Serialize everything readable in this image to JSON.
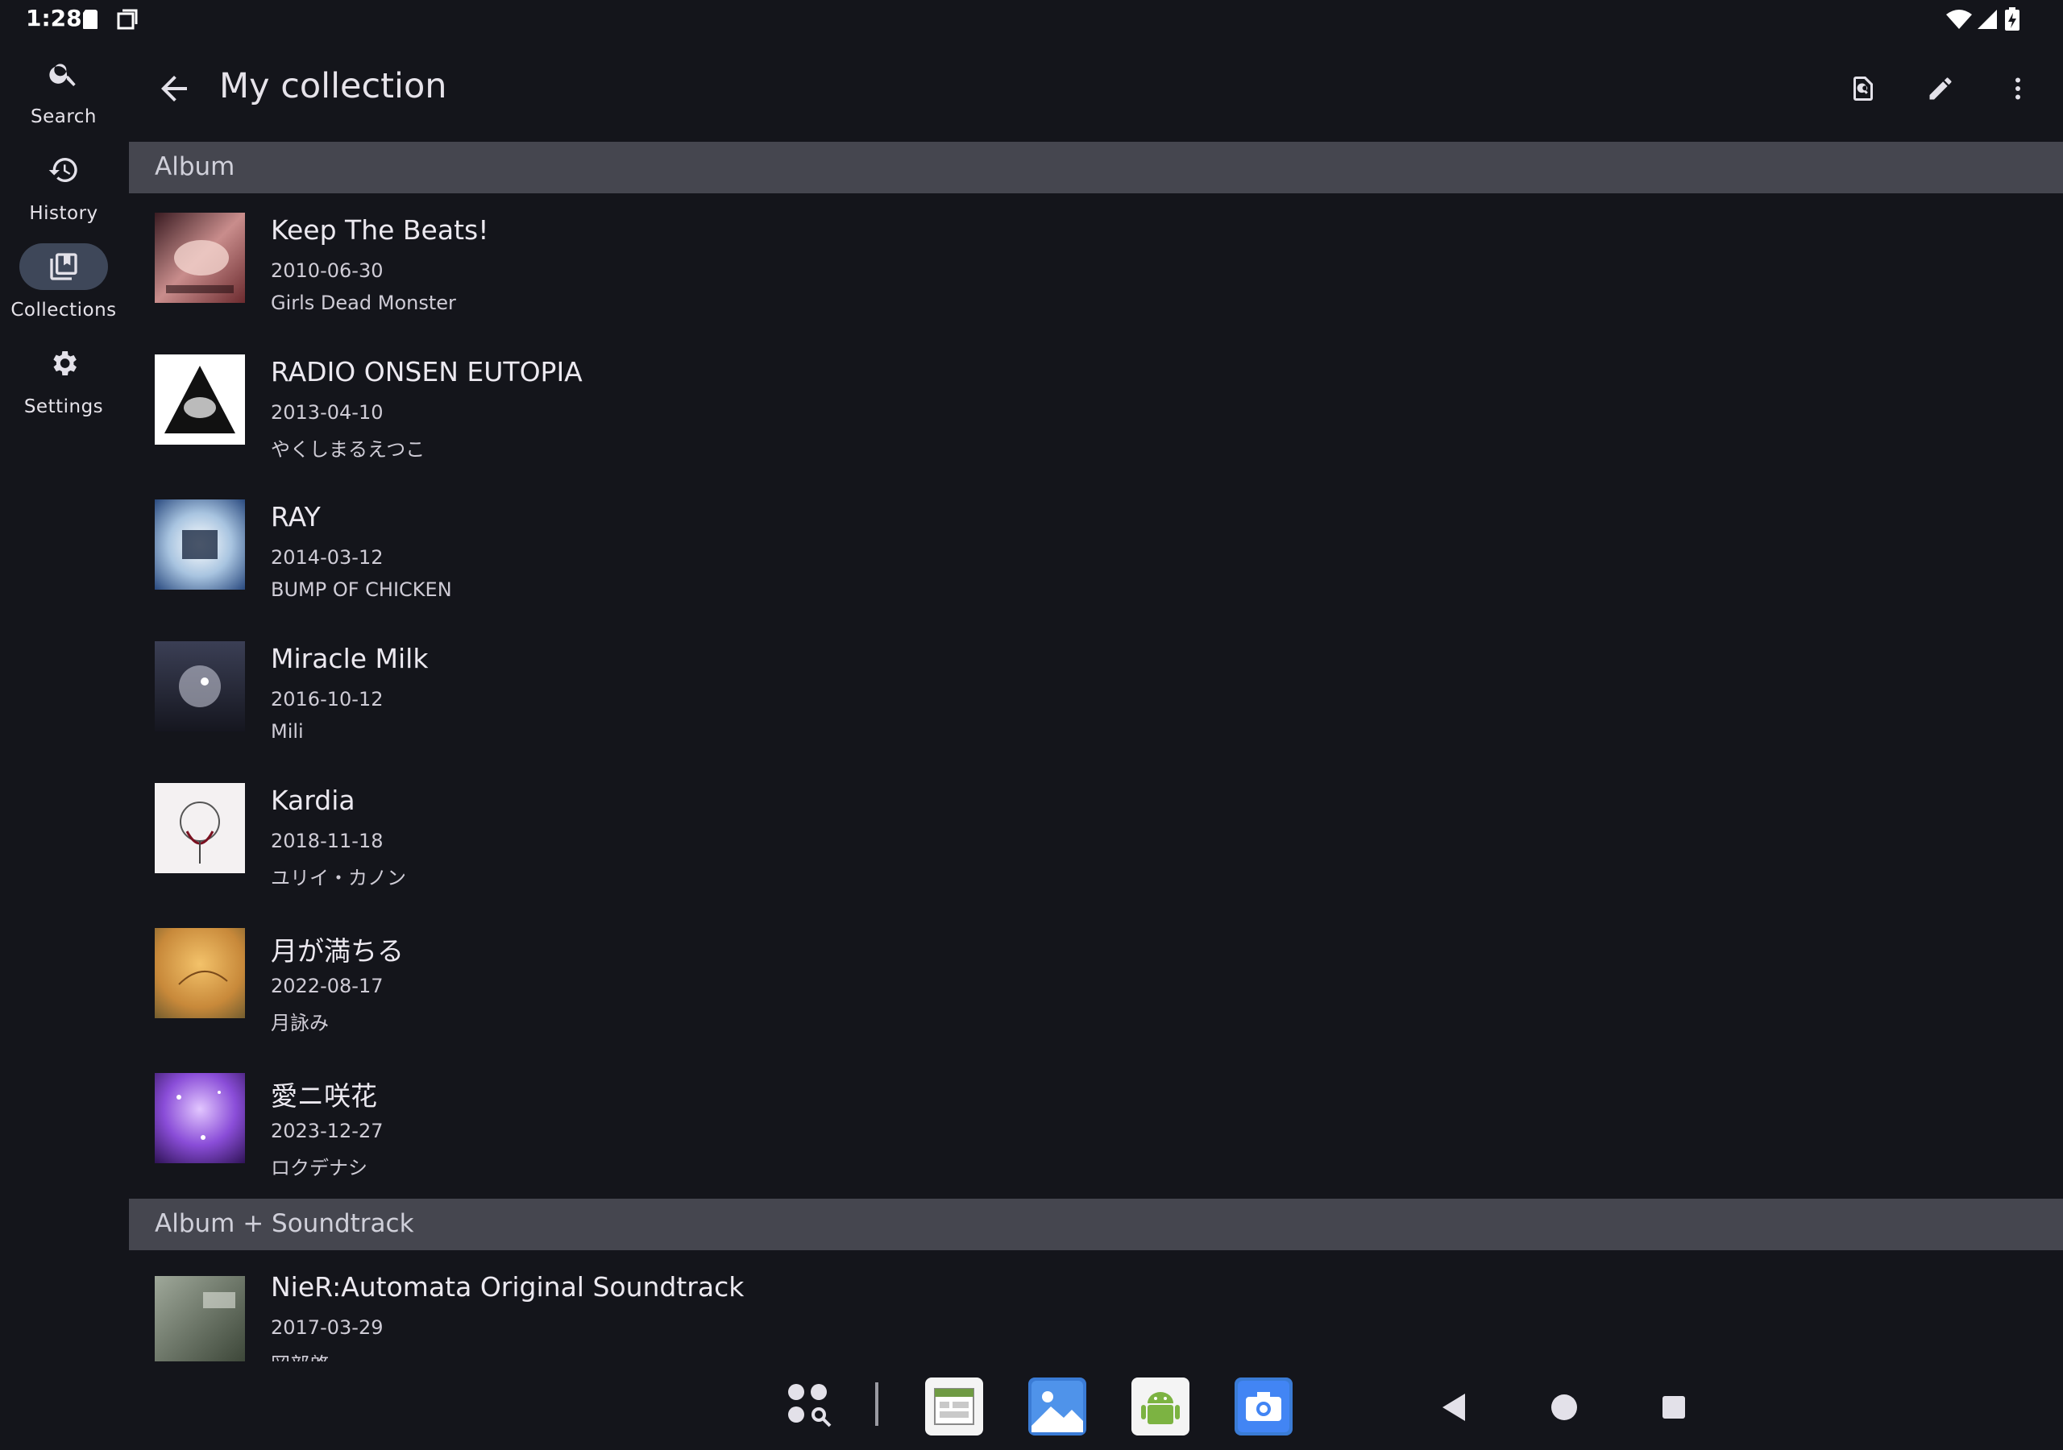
{
  "status_bar": {
    "time": "1:28"
  },
  "nav_rail": {
    "items": [
      {
        "label": "Search",
        "icon": "search-icon",
        "active": false
      },
      {
        "label": "History",
        "icon": "history-icon",
        "active": false
      },
      {
        "label": "Collections",
        "icon": "collections-icon",
        "active": true
      },
      {
        "label": "Settings",
        "icon": "settings-icon",
        "active": false
      }
    ]
  },
  "app_bar": {
    "title": "My collection",
    "actions": [
      "find-in-page-icon",
      "edit-icon",
      "more-vert-icon"
    ]
  },
  "sections": [
    {
      "header": "Album",
      "items": [
        {
          "title": "Keep The Beats!",
          "date": "2010-06-30",
          "artist": "Girls Dead Monster"
        },
        {
          "title": "RADIO ONSEN EUTOPIA",
          "date": "2013-04-10",
          "artist": "やくしまるえつこ"
        },
        {
          "title": "RAY",
          "date": "2014-03-12",
          "artist": "BUMP OF CHICKEN"
        },
        {
          "title": "Miracle Milk",
          "date": "2016-10-12",
          "artist": "Mili"
        },
        {
          "title": "Kardia",
          "date": "2018-11-18",
          "artist": "ユリイ・カノン"
        },
        {
          "title": "月が満ちる",
          "date": "2022-08-17",
          "artist": "月詠み"
        },
        {
          "title": "愛ニ咲花",
          "date": "2023-12-27",
          "artist": "ロクデナシ"
        }
      ]
    },
    {
      "header": "Album + Soundtrack",
      "items": [
        {
          "title": "NieR:Automata Original Soundtrack",
          "date": "2017-03-29",
          "artist": "岡部啓一"
        }
      ]
    }
  ],
  "taskbar": {
    "apps": [
      "all-apps-icon",
      "spreadsheet-app-icon",
      "gallery-app-icon",
      "android-app-icon",
      "camera-app-icon"
    ],
    "nav": [
      "back-nav-icon",
      "home-nav-icon",
      "recents-nav-icon"
    ]
  },
  "colors": {
    "background": "#14151b",
    "section_header": "#45464f",
    "active_rail": "#3e4759"
  }
}
